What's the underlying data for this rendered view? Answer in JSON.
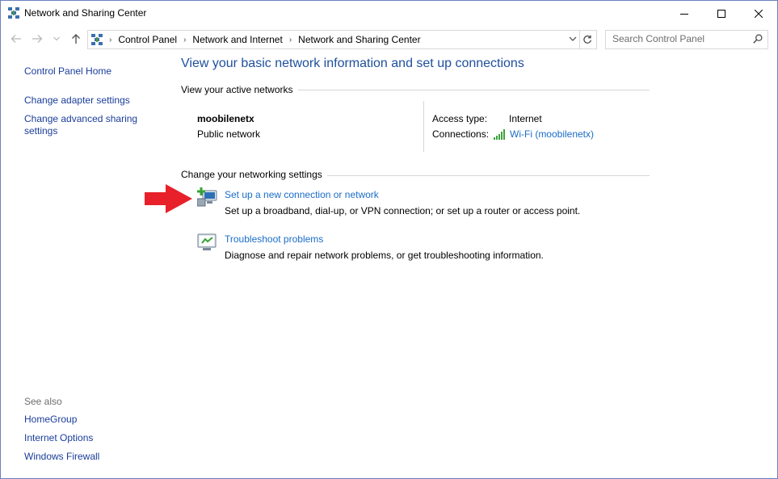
{
  "window": {
    "title": "Network and Sharing Center"
  },
  "address": {
    "crumbs": [
      "Control Panel",
      "Network and Internet",
      "Network and Sharing Center"
    ]
  },
  "search": {
    "placeholder": "Search Control Panel"
  },
  "sidebar": {
    "links": [
      "Control Panel Home",
      "Change adapter settings",
      "Change advanced sharing",
      "settings"
    ],
    "see_also_label": "See also",
    "see_also": [
      "HomeGroup",
      "Internet Options",
      "Windows Firewall"
    ]
  },
  "main": {
    "title": "View your basic network information and set up connections",
    "active_networks_label": "View your active networks",
    "network": {
      "name": "moobilenetx",
      "kind": "Public network",
      "access_type_label": "Access type:",
      "access_type_value": "Internet",
      "connections_label": "Connections:",
      "connection_name": "Wi-Fi (moobilenetx)"
    },
    "change_settings_label": "Change your networking settings",
    "tasks": [
      {
        "title": "Set up a new connection or network",
        "desc": "Set up a broadband, dial-up, or VPN connection; or set up a router or access point.",
        "icon": "new-connection-icon"
      },
      {
        "title": "Troubleshoot problems",
        "desc": "Diagnose and repair network problems, or get troubleshooting information.",
        "icon": "troubleshoot-icon"
      }
    ]
  },
  "colors": {
    "link": "#1a6dc7",
    "heading": "#1e4f9c",
    "annotation_arrow": "#e8202a"
  }
}
